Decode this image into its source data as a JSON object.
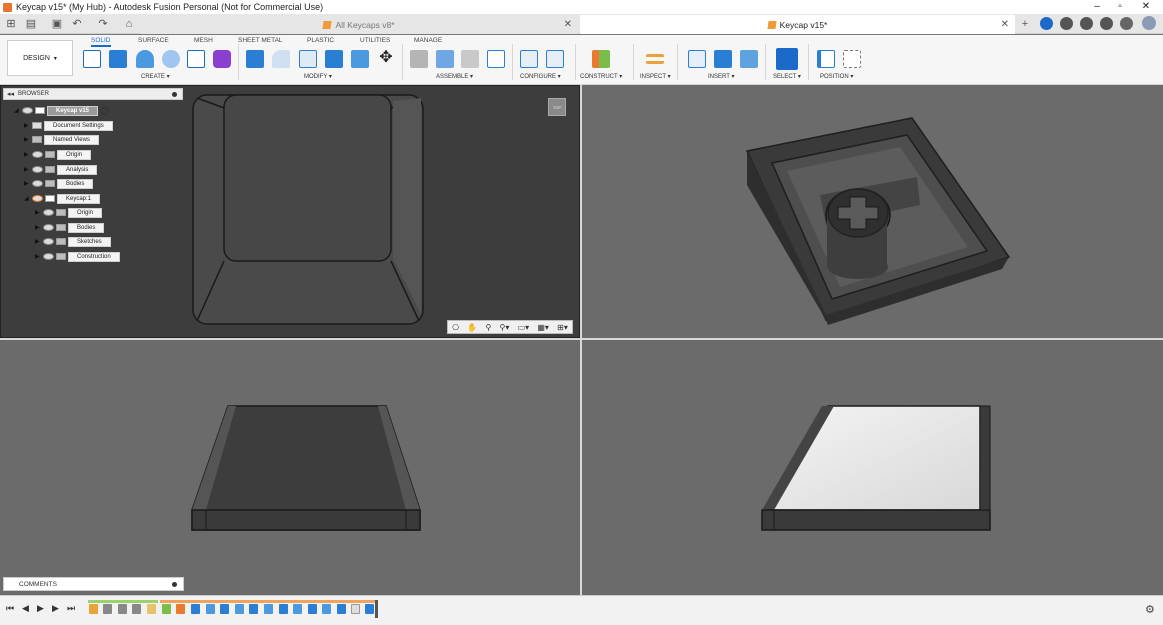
{
  "window": {
    "title": "Keycap v15* (My Hub) - Autodesk Fusion Personal (Not for Commercial Use)"
  },
  "tabs": [
    {
      "label": "All Keycaps v8*"
    },
    {
      "label": "Keycap v15*"
    }
  ],
  "ribbon": {
    "workspace": "DESIGN",
    "tabs": [
      "SOLID",
      "SURFACE",
      "MESH",
      "SHEET METAL",
      "PLASTIC",
      "UTILITIES",
      "MANAGE"
    ],
    "active_tab": "SOLID",
    "groups": [
      "CREATE",
      "MODIFY",
      "ASSEMBLE",
      "CONFIGURE",
      "CONSTRUCT",
      "INSPECT",
      "INSERT",
      "SELECT",
      "POSITION"
    ]
  },
  "browser": {
    "title": "BROWSER",
    "root": "Keycap v15",
    "items": [
      "Document Settings",
      "Named Views",
      "Origin",
      "Analysis",
      "Bodies",
      "Keycap:1"
    ],
    "component_items": [
      "Origin",
      "Bodies",
      "Sketches",
      "Construction"
    ]
  },
  "viewcube": {
    "label": "TOP"
  },
  "comments": {
    "title": "COMMENTS"
  },
  "colors": {
    "accent": "#1b6ac9",
    "brand": "#e8762d",
    "active_viewport_bg": "#3d3d3d",
    "viewport_bg": "#6b6b6b"
  }
}
